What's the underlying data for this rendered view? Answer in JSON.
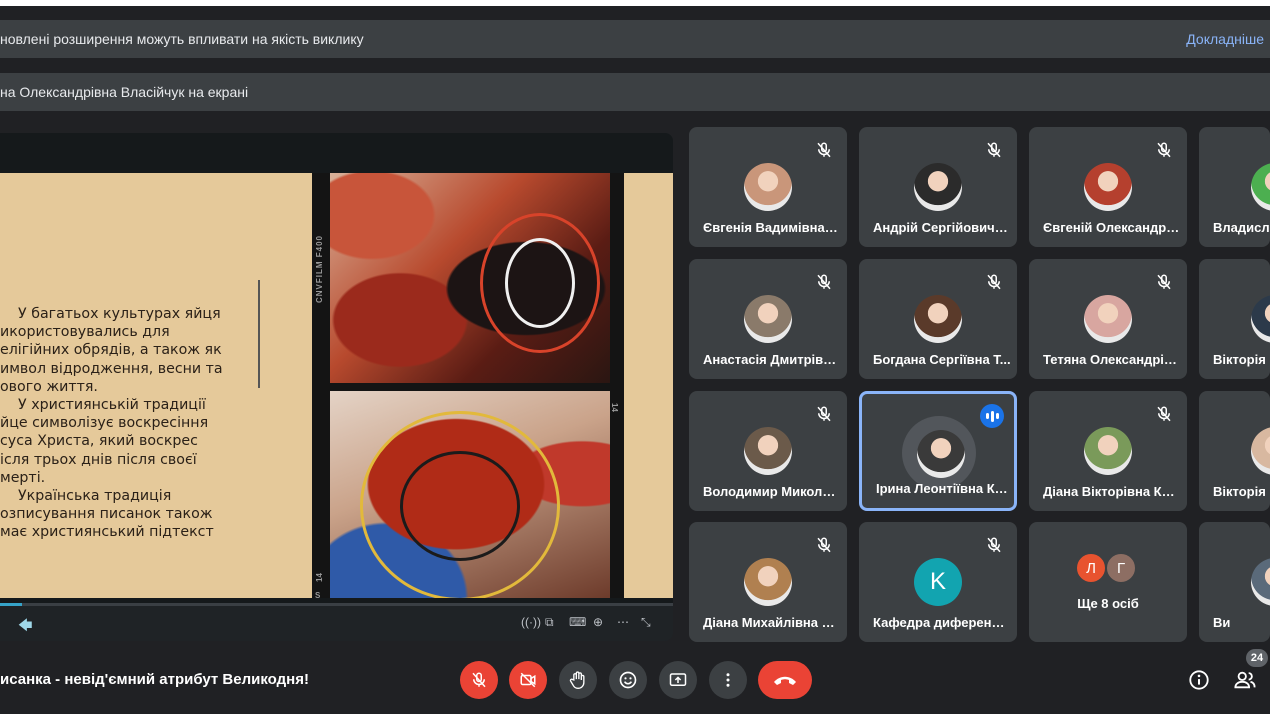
{
  "banners": {
    "extensions_warning": "новлені розширення можуть впливати на якість виклику",
    "learn_more": "Докладніше",
    "presenting": "на Олександрівна Власійчук на екрані"
  },
  "presentation": {
    "slide_text": "    У багатьох культурах яйця\nикористовувались для\nелігійних обрядів, а також як\nимвол відродження, весни та\nового життя.\n    У християнській традиції\nйце символізує воскресіння\nсуса Христа, який воскрес\nісля трьох днів після своєї\nмерті.\n    Українська традиція\nозписування писанок також\nмає християнський підтекст",
    "film_label": "CNVFILM F400",
    "film_num_left": "14",
    "film_num_right": "14",
    "film_mark_bottom": "S",
    "progress_fraction": 0.033
  },
  "participants": [
    {
      "name": "Євгенія Вадимівна Сол...",
      "muted": true,
      "avatar": "photo",
      "color": "#c9967a"
    },
    {
      "name": "Андрій Сергійович Ле...",
      "muted": true,
      "avatar": "photo",
      "color": "#2b2b2b"
    },
    {
      "name": "Євгеній Олександрови...",
      "muted": true,
      "avatar": "photo",
      "color": "#b5402e"
    },
    {
      "name": "Владислав",
      "muted": false,
      "avatar": "photo",
      "color": "#4caf50"
    },
    {
      "name": "Анастасія Дмитрівна...",
      "muted": true,
      "avatar": "photo",
      "color": "#8a7a6a"
    },
    {
      "name": "Богдана Сергіївна Т...",
      "muted": true,
      "avatar": "photo",
      "color": "#5a3a2a"
    },
    {
      "name": "Тетяна Олександрівна...",
      "muted": true,
      "avatar": "photo",
      "color": "#d8a6a0"
    },
    {
      "name": "Вікторія",
      "muted": false,
      "avatar": "photo",
      "color": "#2c3a4a"
    },
    {
      "name": "Володимир Миколайо...",
      "muted": true,
      "avatar": "photo",
      "color": "#6b5a4a"
    },
    {
      "name": "Ірина Леонтіївна Кра...",
      "muted": false,
      "speaking": true,
      "avatar": "photo",
      "color": "#3a3a3a"
    },
    {
      "name": "Діана Вікторівна Кирил...",
      "muted": true,
      "avatar": "photo",
      "color": "#7a9a5a"
    },
    {
      "name": "Вікторія",
      "muted": false,
      "avatar": "photo",
      "color": "#d8b8a0"
    },
    {
      "name": "Діана Михайлівна Коз...",
      "muted": true,
      "avatar": "photo",
      "color": "#b08050"
    },
    {
      "name": "Кафедра диференціа...",
      "muted": true,
      "avatar": "letter",
      "letter": "K",
      "color": "#12a4b0"
    },
    {
      "name": "Ще 8 осіб",
      "muted": false,
      "avatar": "group",
      "letters": [
        "Л",
        "Г"
      ],
      "colors": [
        "#e8532f",
        "#8d6e63"
      ]
    },
    {
      "name": "Ви",
      "muted": false,
      "avatar": "photo",
      "color": "#5a6a7a"
    }
  ],
  "footer": {
    "meeting_title": "исанка - невід'ємний атрибут Великодня!",
    "participant_count": "24"
  },
  "colors": {
    "background": "#202124",
    "tile": "#3c4043",
    "danger": "#ea4335",
    "accent": "#8ab4f8",
    "speaking": "#1a73e8"
  }
}
